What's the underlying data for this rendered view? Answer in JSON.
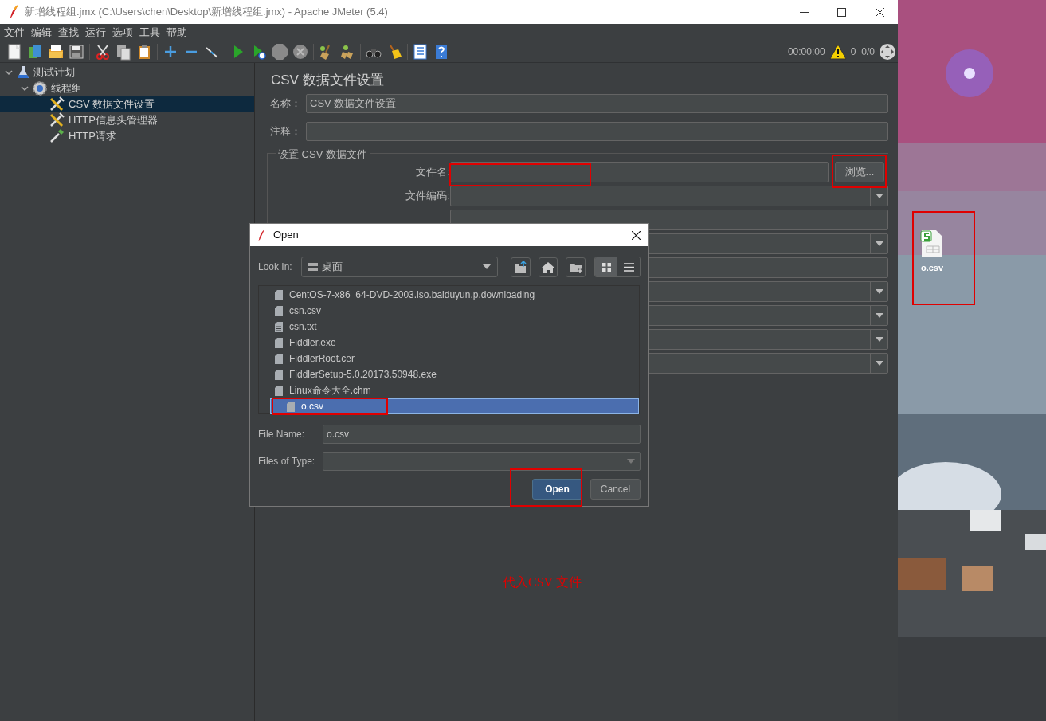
{
  "window": {
    "title": "新增线程组.jmx (C:\\Users\\chen\\Desktop\\新增线程组.jmx) - Apache JMeter (5.4)"
  },
  "menu": [
    "文件",
    "编辑",
    "查找",
    "运行",
    "选项",
    "工具",
    "帮助"
  ],
  "status": {
    "elapsed": "00:00:00",
    "warnings": "0",
    "threads": "0/0"
  },
  "tree": [
    {
      "label": "测试计划",
      "kind": "plan",
      "expanded": true,
      "selected": false,
      "children": [
        {
          "label": "线程组",
          "kind": "threads",
          "expanded": true,
          "selected": false,
          "children": [
            {
              "label": "CSV 数据文件设置",
              "kind": "config",
              "selected": true
            },
            {
              "label": "HTTP信息头管理器",
              "kind": "config",
              "selected": false
            },
            {
              "label": "HTTP请求",
              "kind": "sampler",
              "selected": false
            }
          ]
        }
      ]
    }
  ],
  "panel": {
    "title": "CSV 数据文件设置",
    "name_label": "名称：",
    "name_value": "CSV 数据文件设置",
    "comment_label": "注释：",
    "section_title": "设置 CSV 数据文件",
    "fields": [
      {
        "kind": "file",
        "label": "文件名:",
        "button": "浏览..."
      },
      {
        "kind": "dropdown",
        "label": "文件编码:"
      },
      {
        "kind": "text"
      },
      {
        "kind": "dropdown"
      },
      {
        "kind": "text"
      },
      {
        "kind": "dropdown"
      },
      {
        "kind": "dropdown"
      },
      {
        "kind": "dropdown"
      },
      {
        "kind": "dropdown"
      }
    ]
  },
  "dialog": {
    "title": "Open",
    "look_in_label": "Look In:",
    "look_in_value": "桌面",
    "view": [
      {
        "kind": "list",
        "selected": true
      },
      {
        "kind": "details",
        "selected": false
      }
    ],
    "files": [
      {
        "name": "CentOS-7-x86_64-DVD-2003.iso.baiduyun.p.downloading",
        "kind": "file",
        "selected": false
      },
      {
        "name": "csn.csv",
        "kind": "file",
        "selected": false
      },
      {
        "name": "csn.txt",
        "kind": "text",
        "selected": false
      },
      {
        "name": "Fiddler.exe",
        "kind": "file",
        "selected": false
      },
      {
        "name": "FiddlerRoot.cer",
        "kind": "file",
        "selected": false
      },
      {
        "name": "FiddlerSetup-5.0.20173.50948.exe",
        "kind": "file",
        "selected": false
      },
      {
        "name": "Linux命令大全.chm",
        "kind": "file",
        "selected": false
      },
      {
        "name": "o.csv",
        "kind": "file",
        "selected": true
      }
    ],
    "file_name_label": "File Name:",
    "file_name_value": "o.csv",
    "file_type_label": "Files of Type:",
    "buttons": [
      {
        "label": "Open",
        "kind": "default"
      },
      {
        "label": "Cancel",
        "kind": "normal"
      }
    ]
  },
  "desktop": {
    "icon_label": "o.csv"
  },
  "annotation": {
    "text": "代入CSV 文件"
  }
}
